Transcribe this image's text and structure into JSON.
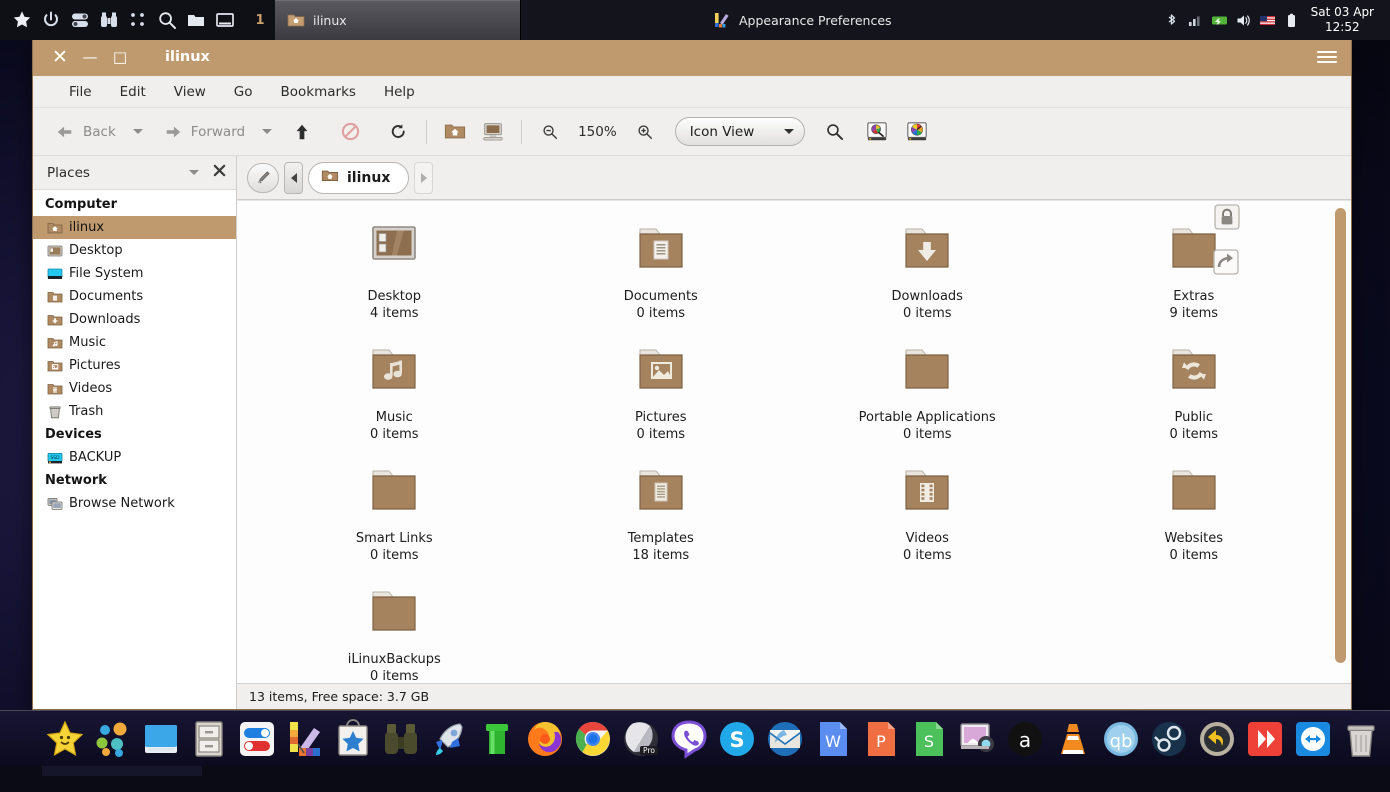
{
  "top_panel": {
    "launcher_icons": [
      "star-icon",
      "power-icon",
      "toggle-icon",
      "binoculars-icon",
      "grid-dots-icon",
      "search-icon",
      "folder-icon",
      "window-icon"
    ],
    "workspace_label": "1",
    "tasks": [
      {
        "label": "ilinux",
        "icon": "home-folder-icon",
        "active": true
      },
      {
        "label": "Appearance Preferences",
        "icon": "appearance-icon",
        "active": false
      }
    ],
    "tray_icons": [
      "bluetooth-icon",
      "signal-bars-icon",
      "network-icon",
      "volume-icon",
      "us-flag-icon",
      "battery-icon"
    ],
    "clock_date": "Sat 03 Apr",
    "clock_time": "12:52"
  },
  "window": {
    "title": "ilinux",
    "close_label": "✕",
    "minimize_label": "—",
    "maximize_label": "□",
    "menu_button": "hamburger-menu-icon",
    "menubar": [
      "File",
      "Edit",
      "View",
      "Go",
      "Bookmarks",
      "Help"
    ],
    "toolbar": {
      "back_label": "Back",
      "forward_label": "Forward",
      "up_icon": "arrow-up-icon",
      "stop_icon": "stop-icon",
      "reload_icon": "reload-icon",
      "home_icon": "home-folder-icon",
      "computer_icon": "computer-icon",
      "zoom_out_icon": "zoom-out-icon",
      "zoom_level": "150%",
      "zoom_in_icon": "zoom-in-icon",
      "view_mode": "Icon View",
      "search_icon": "search-icon",
      "find_files_icon": "find-files-icon",
      "color_picker_icon": "color-wheel-icon"
    },
    "sidebar": {
      "header": "Places",
      "header_dropdown_icon": "chevron-down-icon",
      "header_close_icon": "close-icon",
      "groups": [
        {
          "title": "Computer",
          "items": [
            {
              "label": "ilinux",
              "icon": "home-folder-icon",
              "selected": true
            },
            {
              "label": "Desktop",
              "icon": "desktop-icon",
              "selected": false
            },
            {
              "label": "File System",
              "icon": "drive-icon",
              "selected": false
            },
            {
              "label": "Documents",
              "icon": "documents-folder-icon",
              "selected": false
            },
            {
              "label": "Downloads",
              "icon": "downloads-folder-icon",
              "selected": false
            },
            {
              "label": "Music",
              "icon": "music-folder-icon",
              "selected": false
            },
            {
              "label": "Pictures",
              "icon": "pictures-folder-icon",
              "selected": false
            },
            {
              "label": "Videos",
              "icon": "videos-folder-icon",
              "selected": false
            },
            {
              "label": "Trash",
              "icon": "trash-icon",
              "selected": false
            }
          ]
        },
        {
          "title": "Devices",
          "items": [
            {
              "label": "BACKUP",
              "icon": "ssd-drive-icon",
              "selected": false
            }
          ]
        },
        {
          "title": "Network",
          "items": [
            {
              "label": "Browse Network",
              "icon": "network-browse-icon",
              "selected": false
            }
          ]
        }
      ]
    },
    "pathbar": {
      "edit_icon": "pencil-path-icon",
      "scroll_left_icon": "triangle-left-icon",
      "scroll_right_icon": "triangle-right-icon",
      "crumbs": [
        {
          "label": "ilinux",
          "icon": "home-folder-icon",
          "active": true
        }
      ]
    },
    "files": [
      {
        "name": "Desktop",
        "count": "4 items",
        "icon": "desktop-picture-icon",
        "badges": []
      },
      {
        "name": "Documents",
        "count": "0 items",
        "icon": "documents-folder-icon",
        "badges": []
      },
      {
        "name": "Downloads",
        "count": "0 items",
        "icon": "downloads-folder-icon",
        "badges": []
      },
      {
        "name": "Extras",
        "count": "9 items",
        "icon": "plain-folder-icon",
        "badges": [
          "lock-badge",
          "symlink-badge"
        ]
      },
      {
        "name": "Music",
        "count": "0 items",
        "icon": "music-folder-icon",
        "badges": []
      },
      {
        "name": "Pictures",
        "count": "0 items",
        "icon": "pictures-folder-icon",
        "badges": []
      },
      {
        "name": "Portable Applications",
        "count": "0 items",
        "icon": "plain-folder-icon",
        "badges": []
      },
      {
        "name": "Public",
        "count": "0 items",
        "icon": "public-folder-icon",
        "badges": []
      },
      {
        "name": "Smart Links",
        "count": "0 items",
        "icon": "plain-folder-icon",
        "badges": []
      },
      {
        "name": "Templates",
        "count": "18 items",
        "icon": "templates-folder-icon",
        "badges": []
      },
      {
        "name": "Videos",
        "count": "0 items",
        "icon": "videos-folder-icon",
        "badges": []
      },
      {
        "name": "Websites",
        "count": "0 items",
        "icon": "plain-folder-icon",
        "badges": []
      },
      {
        "name": "iLinuxBackups",
        "count": "0 items",
        "icon": "plain-folder-icon",
        "badges": []
      }
    ],
    "statusbar": "13 items, Free space: 3.7 GB"
  },
  "dock": {
    "items": [
      "star-smiley-icon",
      "dots-cluster-icon",
      "window-blue-icon",
      "file-cabinet-icon",
      "toggles-icon",
      "color-swatch-icon",
      "app-store-icon",
      "binoculars-icon",
      "rocket-icon",
      "green-pipe-icon",
      "firefox-icon",
      "chrome-icon",
      "opera-pro-icon",
      "viber-icon",
      "skype-icon",
      "thunderbird-icon",
      "word-icon",
      "powerpoint-icon",
      "sheets-icon",
      "webcam-icon",
      "amazon-icon",
      "vlc-icon",
      "qbittorrent-icon",
      "steam-icon",
      "undo-icon",
      "anydesk-icon",
      "teamviewer-icon",
      "trash-icon"
    ]
  },
  "colors": {
    "accent": "#bf9a6e",
    "panel_dark": "#14141c",
    "window_bg": "#f0efee",
    "folder_body": "#a58460"
  }
}
